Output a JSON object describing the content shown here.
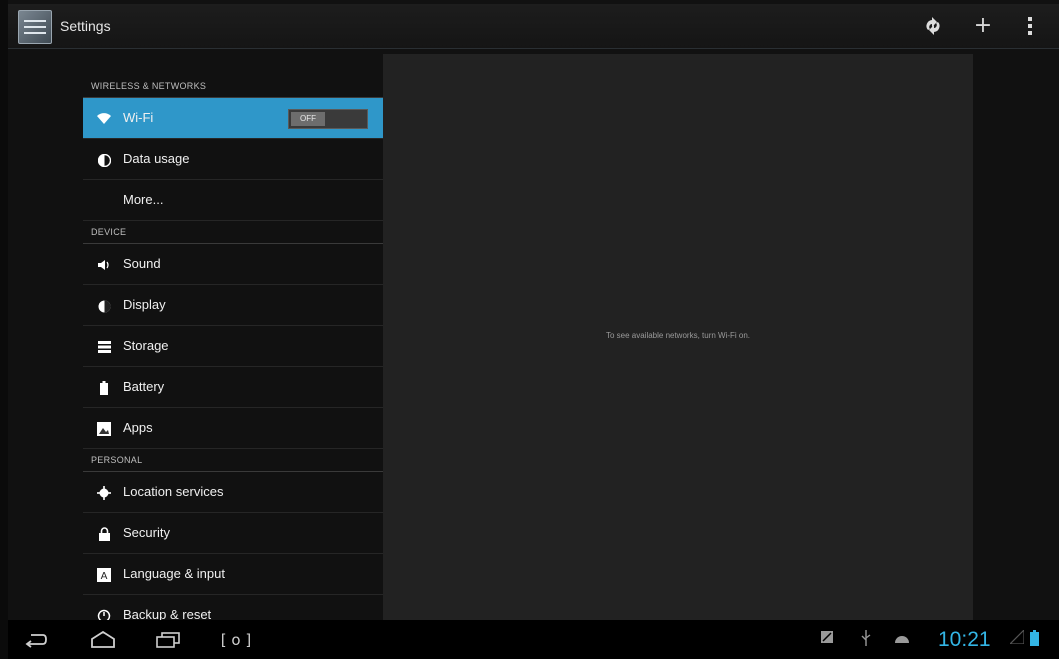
{
  "action_bar": {
    "title": "Settings",
    "icons": {
      "app": "settings-app-icon",
      "sync": "sync-icon",
      "add": "add-icon",
      "overflow": "overflow-menu-icon"
    }
  },
  "settings": {
    "sections": [
      {
        "header": "WIRELESS & NETWORKS",
        "items": [
          {
            "label": "Wi-Fi",
            "icon": "wifi-icon",
            "toggle": "OFF",
            "selected": true
          },
          {
            "label": "Data usage",
            "icon": "data-usage-icon"
          },
          {
            "label": "More...",
            "icon": null
          }
        ]
      },
      {
        "header": "DEVICE",
        "items": [
          {
            "label": "Sound",
            "icon": "sound-icon"
          },
          {
            "label": "Display",
            "icon": "display-icon"
          },
          {
            "label": "Storage",
            "icon": "storage-icon"
          },
          {
            "label": "Battery",
            "icon": "battery-icon"
          },
          {
            "label": "Apps",
            "icon": "apps-icon"
          }
        ]
      },
      {
        "header": "PERSONAL",
        "items": [
          {
            "label": "Location services",
            "icon": "location-icon"
          },
          {
            "label": "Security",
            "icon": "security-icon"
          },
          {
            "label": "Language & input",
            "icon": "language-icon"
          },
          {
            "label": "Backup & reset",
            "icon": "backup-icon"
          }
        ]
      }
    ]
  },
  "detail": {
    "message": "To see available networks, turn Wi-Fi on."
  },
  "system_bar": {
    "clock": "10:21",
    "nav": {
      "back": "back-icon",
      "home": "home-icon",
      "recents": "recent-apps-icon",
      "screenshot": "screenshot-icon"
    },
    "status": {
      "notification": "notification-icon",
      "usb": "usb-icon",
      "android": "android-debug-icon",
      "signal": "signal-icon",
      "battery": "battery-status-icon"
    }
  },
  "colors": {
    "accent": "#33b5e5",
    "selected_bg": "#2f97c9",
    "pane_bg": "#222222",
    "bar_bg": "#000000"
  }
}
